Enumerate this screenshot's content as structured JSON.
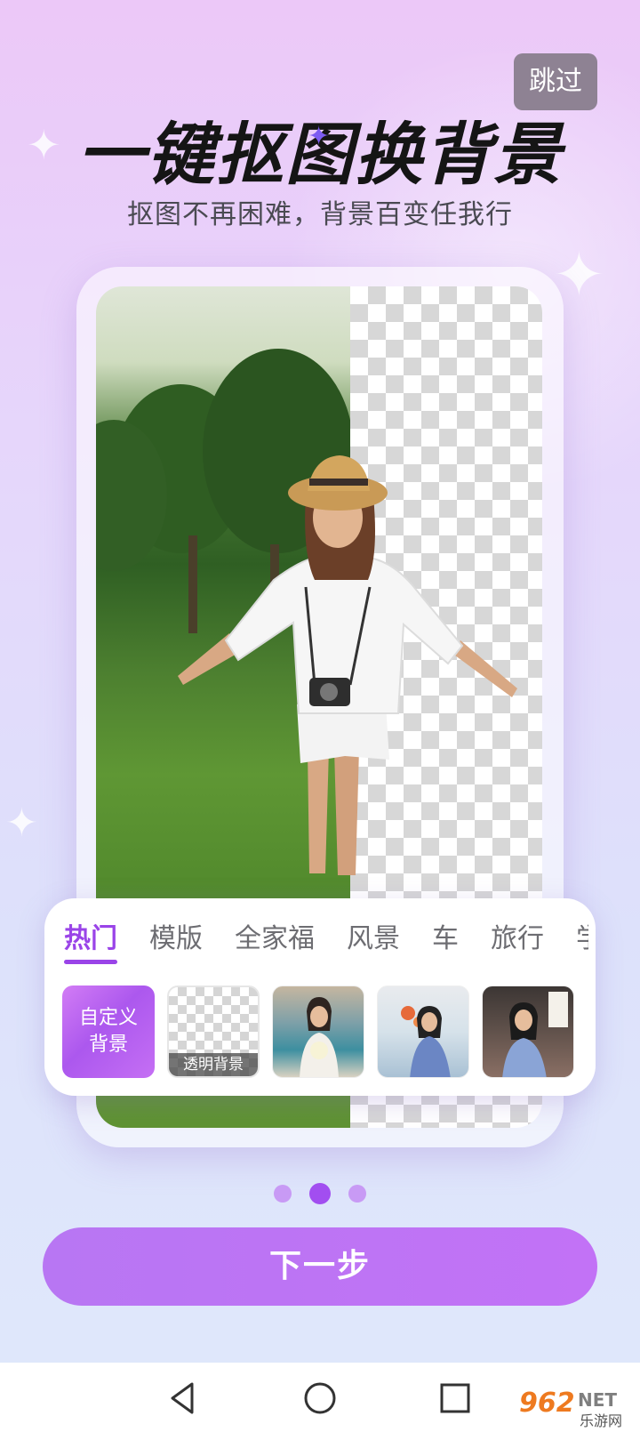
{
  "skip_label": "跳过",
  "title": "一键抠图换背景",
  "subtitle": "抠图不再困难，背景百变任我行",
  "tabs": [
    {
      "label": "热门",
      "active": true
    },
    {
      "label": "模版",
      "active": false
    },
    {
      "label": "全家福",
      "active": false
    },
    {
      "label": "风景",
      "active": false
    },
    {
      "label": "车",
      "active": false
    },
    {
      "label": "旅行",
      "active": false
    },
    {
      "label": "学校",
      "active": false
    }
  ],
  "backgrounds": {
    "custom_line1": "自定义",
    "custom_line2": "背景",
    "transparent_label": "透明背景"
  },
  "pager": {
    "count": 3,
    "active_index": 1
  },
  "next_label": "下一步",
  "colors": {
    "accent": "#9a44e8",
    "button": "#c070f5",
    "skip_bg": "#8e8293"
  },
  "icons": {
    "back": "back-triangle-icon",
    "home": "home-circle-icon",
    "recents": "recents-square-icon"
  },
  "watermark": {
    "brand": "962",
    "net": "NET",
    "cn": "乐游网"
  }
}
